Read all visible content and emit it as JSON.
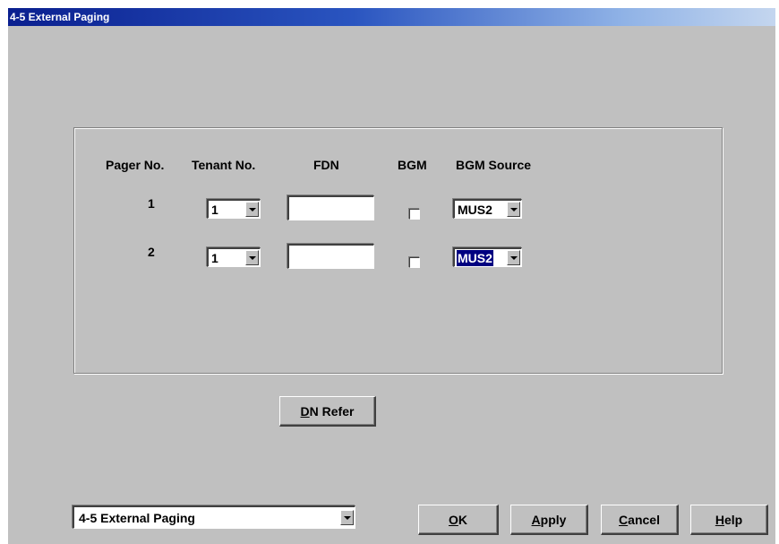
{
  "window": {
    "title": "4-5 External Paging"
  },
  "table": {
    "headers": {
      "pager_no": "Pager No.",
      "tenant_no": "Tenant No.",
      "fdn": "FDN",
      "bgm": "BGM",
      "bgm_source": "BGM Source"
    },
    "rows": [
      {
        "pager_no": "1",
        "tenant_no": "1",
        "fdn": "",
        "bgm": false,
        "bgm_source": "MUS2"
      },
      {
        "pager_no": "2",
        "tenant_no": "1",
        "fdn": "",
        "bgm": false,
        "bgm_source": "MUS2"
      }
    ]
  },
  "buttons": {
    "dn_refer": {
      "mnemonic": "D",
      "rest": "N Refer"
    },
    "ok": {
      "mnemonic": "O",
      "rest": "K"
    },
    "apply": {
      "mnemonic": "A",
      "rest": "pply"
    },
    "cancel": {
      "mnemonic": "C",
      "rest": "ancel"
    },
    "help": {
      "mnemonic": "H",
      "rest": "elp"
    }
  },
  "page_selector": {
    "value": "4-5 External Paging"
  },
  "colors": {
    "face": "#c0c0c0",
    "title_gradient_start": "#0a1f8f",
    "selection": "#000080"
  },
  "icons": {
    "dropdown": "chevron-down-icon",
    "checkbox": "checkbox-unchecked-icon"
  }
}
